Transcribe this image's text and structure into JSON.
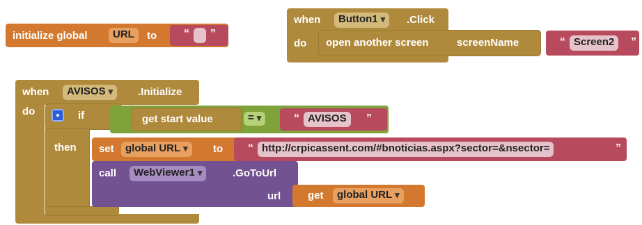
{
  "init_block": {
    "label": "initialize global",
    "var_name": "URL",
    "to_label": "to",
    "quote_open": "“",
    "quote_close": "”",
    "value": ""
  },
  "click_block": {
    "when_label": "when",
    "component": "Button1",
    "event": ".Click",
    "do_label": "do",
    "action_label": "open another screen",
    "param_label": "screenName",
    "quote_open": "“",
    "quote_close": "”",
    "screen_value": "Screen2"
  },
  "init_event_block": {
    "when_label": "when",
    "component": "AVISOS",
    "event": ".Initialize",
    "do_label": "do",
    "if_label": "if",
    "then_label": "then",
    "get_start_label": "get start value",
    "compare_op": "=",
    "quote_open": "“",
    "quote_close": "”",
    "compare_value": "AVISOS",
    "set_label": "set",
    "set_var": "global URL",
    "set_to_label": "to",
    "url_value": "http://crpicassent.com/#bnoticias.aspx?sector=&nsector=",
    "call_label": "call",
    "call_component": "WebViewer1",
    "call_method": ".GoToUrl",
    "url_param_label": "url",
    "get_label": "get",
    "get_var": "global URL"
  },
  "colors": {
    "variable_orange": "#d2782f",
    "control_gold": "#b08a3c",
    "text_red": "#b84a5d",
    "logic_green": "#7fa23a",
    "component_purple": "#735291",
    "mutator_blue": "#2a5bd7"
  }
}
